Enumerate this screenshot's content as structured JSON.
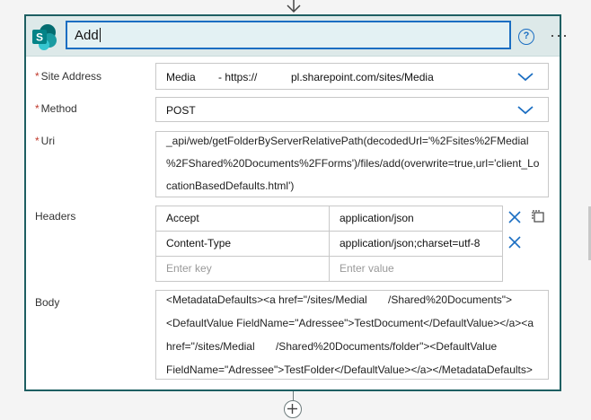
{
  "action": {
    "title": "Add",
    "help_glyph": "?",
    "more_glyph": "···"
  },
  "fields": {
    "site_address": {
      "label": "Site Address",
      "value_part1": "Media",
      "value_part2": "- https://",
      "value_part3": "pl.sharepoint.com/sites/Media"
    },
    "method": {
      "label": "Method",
      "value": "POST"
    },
    "uri": {
      "label": "Uri",
      "lines": [
        "_api/web/getFolderByServerRelativePath(decodedUrl='%2Fsites%2FMedial",
        "%2FShared%20Documents%2FForms')/files/add(overwrite=true,url='client_Lo",
        "cationBasedDefaults.html')"
      ]
    },
    "headers": {
      "label": "Headers",
      "rows": [
        {
          "key": "Accept",
          "value": "application/json"
        },
        {
          "key": "Content-Type",
          "value": "application/json;charset=utf-8"
        }
      ],
      "key_placeholder": "Enter key",
      "value_placeholder": "Enter value"
    },
    "body": {
      "label": "Body",
      "lines": [
        "<MetadataDefaults><a href=\"/sites/Medial       /Shared%20Documents\">",
        "<DefaultValue FieldName=\"Adressee\">TestDocument</DefaultValue></a><a",
        "href=\"/sites/Medial       /Shared%20Documents/folder\"><DefaultValue",
        "FieldName=\"Adressee\">TestFolder</DefaultValue></a></MetadataDefaults>"
      ]
    }
  },
  "icons": {
    "logo": "sharepoint-logo",
    "dropdown": "chevron-down-icon",
    "remove": "close-icon",
    "copy": "copy-icon",
    "add": "plus-icon",
    "down_arrow": "arrow-down-icon"
  },
  "colors": {
    "accent": "#1b6ec2",
    "card_border": "#1e5f62",
    "header_bg": "#dde9e9",
    "required": "#c0392b",
    "sharepoint": "#038387"
  }
}
